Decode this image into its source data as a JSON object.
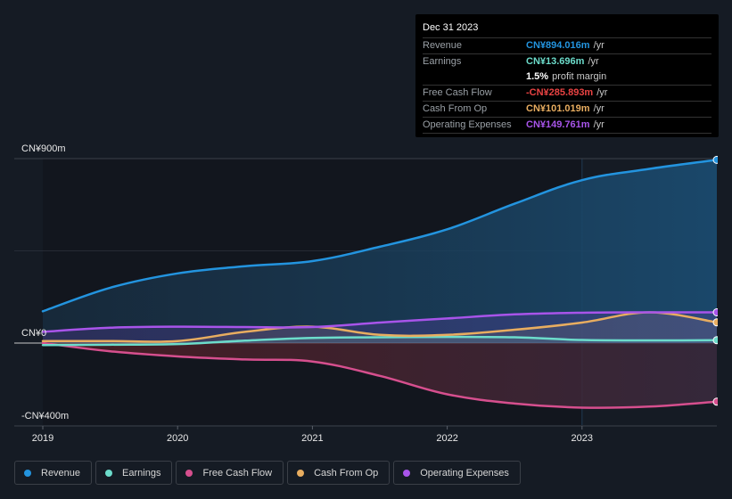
{
  "tooltip": {
    "date": "Dec 31 2023",
    "rows": [
      {
        "label": "Revenue",
        "value": "CN¥894.016m",
        "suffix": "/yr",
        "color": "#2394df"
      },
      {
        "label": "Earnings",
        "value": "CN¥13.696m",
        "suffix": "/yr",
        "color": "#6cdccb"
      },
      {
        "label": "",
        "value": "1.5%",
        "suffix": "profit margin",
        "color": "#ffffff"
      },
      {
        "label": "Free Cash Flow",
        "value": "-CN¥285.893m",
        "suffix": "/yr",
        "color": "#ea4343"
      },
      {
        "label": "Cash From Op",
        "value": "CN¥101.019m",
        "suffix": "/yr",
        "color": "#e8ad60"
      },
      {
        "label": "Operating Expenses",
        "value": "CN¥149.761m",
        "suffix": "/yr",
        "color": "#a854ea"
      }
    ]
  },
  "chart_data": {
    "type": "area",
    "title": "",
    "xlabel": "",
    "ylabel": "",
    "currency": "CN¥",
    "ylim": [
      -400,
      900
    ],
    "y_tick_labels": [
      {
        "value": 900,
        "label": "CN¥900m"
      },
      {
        "value": 0,
        "label": "CN¥0"
      },
      {
        "value": -400,
        "label": "-CN¥400m"
      }
    ],
    "x_tick_labels": [
      "2019",
      "2020",
      "2021",
      "2022",
      "2023"
    ],
    "xlim": [
      2019.0,
      2024.0
    ],
    "x": [
      2019.0,
      2019.5,
      2020.0,
      2020.5,
      2021.0,
      2021.5,
      2022.0,
      2022.5,
      2023.0,
      2023.5,
      2024.0
    ],
    "highlight_from": 2023.0,
    "grid": true,
    "legend_position": "bottom-left",
    "series": [
      {
        "name": "Revenue",
        "color": "#2394df",
        "values": [
          155,
          270,
          340,
          375,
          400,
          470,
          555,
          680,
          795,
          850,
          894
        ]
      },
      {
        "name": "Earnings",
        "color": "#6cdccb",
        "values": [
          -10,
          -8,
          -5,
          12,
          25,
          28,
          30,
          28,
          15,
          13,
          14
        ]
      },
      {
        "name": "Free Cash Flow",
        "color": "#d64f8e",
        "values": [
          0,
          -40,
          -65,
          -80,
          -90,
          -160,
          -250,
          -295,
          -315,
          -310,
          -286
        ]
      },
      {
        "name": "Cash From Op",
        "color": "#e8ad60",
        "values": [
          10,
          10,
          10,
          55,
          80,
          40,
          40,
          65,
          100,
          150,
          101
        ]
      },
      {
        "name": "Operating Expenses",
        "color": "#a854ea",
        "values": [
          55,
          75,
          80,
          78,
          78,
          100,
          120,
          140,
          148,
          150,
          150
        ]
      }
    ]
  },
  "legend": [
    {
      "label": "Revenue",
      "color": "#2394df"
    },
    {
      "label": "Earnings",
      "color": "#6cdccb"
    },
    {
      "label": "Free Cash Flow",
      "color": "#d64f8e"
    },
    {
      "label": "Cash From Op",
      "color": "#e8ad60"
    },
    {
      "label": "Operating Expenses",
      "color": "#a854ea"
    }
  ]
}
